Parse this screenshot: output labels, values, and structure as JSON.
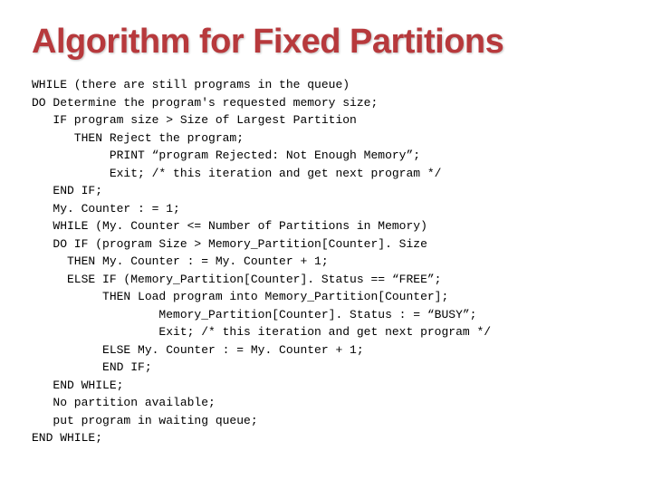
{
  "title": "Algorithm for Fixed Partitions",
  "code": {
    "l1": "WHILE (there are still programs in the queue)",
    "l2": "DO Determine the program's requested memory size;",
    "l3": "   IF program size > Size of Largest Partition",
    "l4": "      THEN Reject the program;",
    "l5": "           PRINT “program Rejected: Not Enough Memory”;",
    "l6": "           Exit; /* this iteration and get next program */",
    "l7": "   END IF;",
    "l8": "   My. Counter : = 1;",
    "l9": "   WHILE (My. Counter <= Number of Partitions in Memory)",
    "l10": "   DO IF (program Size > Memory_Partition[Counter]. Size",
    "l11": "     THEN My. Counter : = My. Counter + 1;",
    "l12": "     ELSE IF (Memory_Partition[Counter]. Status == “FREE”;",
    "l13": "          THEN Load program into Memory_Partition[Counter];",
    "l14": "                  Memory_Partition[Counter]. Status : = “BUSY”;",
    "l15": "                  Exit; /* this iteration and get next program */",
    "l16": "          ELSE My. Counter : = My. Counter + 1;",
    "l17": "          END IF;",
    "l18": "   END WHILE;",
    "l19": "   No partition available;",
    "l20": "   put program in waiting queue;",
    "l21": "END WHILE;"
  }
}
